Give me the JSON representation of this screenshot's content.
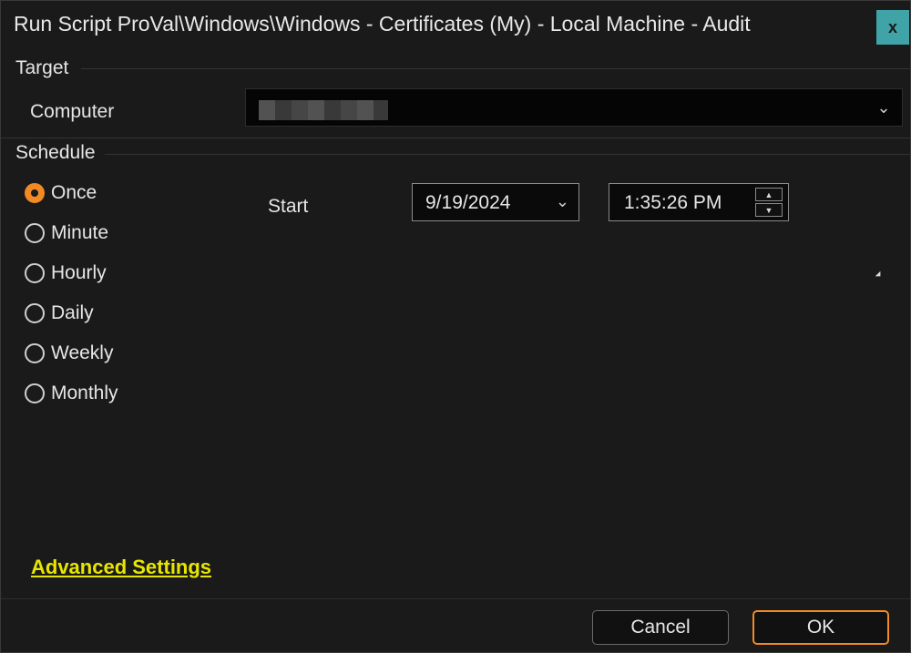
{
  "window": {
    "title": "Run Script ProVal\\Windows\\Windows - Certificates (My) - Local Machine - Audit",
    "close_label": "x"
  },
  "target": {
    "section_label": "Target",
    "computer_label": "Computer",
    "computer_value": ""
  },
  "schedule": {
    "section_label": "Schedule",
    "options": [
      {
        "label": "Once",
        "checked": true
      },
      {
        "label": "Minute",
        "checked": false
      },
      {
        "label": "Hourly",
        "checked": false
      },
      {
        "label": "Daily",
        "checked": false
      },
      {
        "label": "Weekly",
        "checked": false
      },
      {
        "label": "Monthly",
        "checked": false
      }
    ],
    "start_label": "Start",
    "start_date": "9/19/2024",
    "start_time": "1:35:26 PM"
  },
  "advanced_settings_label": "Advanced Settings",
  "buttons": {
    "cancel": "Cancel",
    "ok": "OK"
  },
  "colors": {
    "accent": "#f08a24",
    "link": "#e8e600",
    "close_bg": "#3fa3a8",
    "background": "#1a1a1a"
  }
}
